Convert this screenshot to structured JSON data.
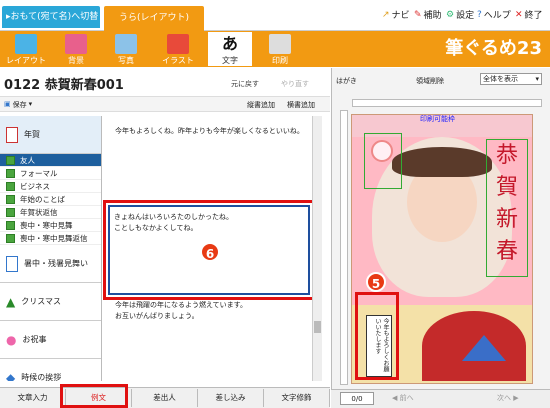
{
  "header": {
    "tab1": "おもて(宛て名)へ切替",
    "tab2": "うら(レイアウト)",
    "navi": "ナビ",
    "hojo": "補助",
    "settei": "設定",
    "help": "ヘルプ",
    "end": "終了"
  },
  "toolbar": {
    "items": [
      "レイアウト",
      "背景",
      "写真",
      "イラスト",
      "文字",
      "印刷"
    ],
    "logo": "筆ぐるめ23",
    "active": "文字"
  },
  "doc": {
    "title": "0122 恭賀新春001",
    "undo": "元に戻す",
    "redo": "やり直す",
    "save": "保存",
    "vertical_add": "縦書追加",
    "horizontal_add": "横書追加"
  },
  "categories": {
    "nenga": "年賀",
    "subs": [
      "友人",
      "フォーマル",
      "ビジネス",
      "年始のことば",
      "年賀状返信",
      "喪中・寒中見舞",
      "喪中・寒中見舞返信"
    ],
    "selected_sub": "友人",
    "shochu": "暑中・残暑見舞い",
    "christmas": "クリスマス",
    "celebration": "お祝事",
    "season": "時候の挨拶"
  },
  "messages": {
    "m1": "今年もよろしくね。昨年よりも今年が楽しくなるといいね。",
    "m2a": "きょねんはいろいろたのしかったね。",
    "m2b": "ことしもなかよくしてね。",
    "m3a": "今年は飛躍の年になるよう燃えています。",
    "m3b": "お互いがんばりましょう。"
  },
  "bottom_tabs": [
    "文章入力",
    "例文",
    "差出人",
    "差し込み",
    "文字修飾"
  ],
  "right": {
    "hagaki": "はがき",
    "area_delete": "領域削除",
    "view": "全体を表示",
    "print_area": "印刷可能枠",
    "page": "0/0",
    "prev": "前へ",
    "next": "次へ",
    "greeting_lines": [
      "今年もよろしく",
      "お願いいたします"
    ],
    "kanji": [
      "恭",
      "賀",
      "新",
      "春"
    ]
  },
  "callouts": {
    "five": "5",
    "six": "6"
  },
  "colors": {
    "orange": "#f29a12",
    "red": "#e01010",
    "blue": "#1e5f9e"
  }
}
